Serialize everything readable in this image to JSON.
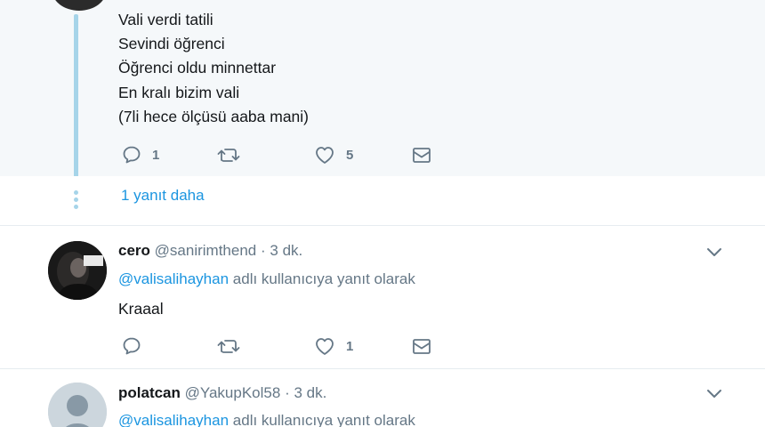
{
  "top_tweet": {
    "lines": [
      "Vali verdi tatili",
      "Sevindi öğrenci",
      "Öğrenci oldu minnettar",
      "En kralı bizim vali",
      "(7li hece ölçüsü aaba mani)"
    ],
    "reply_count": "1",
    "retweet_count": "",
    "like_count": "5"
  },
  "thread": {
    "more_replies_label": "1 yanıt daha"
  },
  "replies": [
    {
      "name": "cero",
      "handle": "@sanirimthend",
      "separator": "·",
      "time": "3 dk.",
      "mention": "@valisalihayhan",
      "replying_suffix": "adlı kullanıcıya yanıt olarak",
      "text": "Kraaal",
      "reply_count": "",
      "retweet_count": "",
      "like_count": "1"
    },
    {
      "name": "polatcan",
      "handle": "@YakupKol58",
      "separator": "·",
      "time": "3 dk.",
      "mention": "@valisalihayhan",
      "replying_suffix": "adlı kullanıcıya yanıt olarak"
    }
  ],
  "icons": {
    "reply": "reply-icon",
    "retweet": "retweet-icon",
    "like": "heart-icon",
    "dm": "envelope-icon",
    "more": "chevron-down-icon"
  },
  "colors": {
    "link": "#1b95e0",
    "secondary": "#657786",
    "thread": "#a6d4e9",
    "highlight_bg": "#f5f8fa"
  }
}
